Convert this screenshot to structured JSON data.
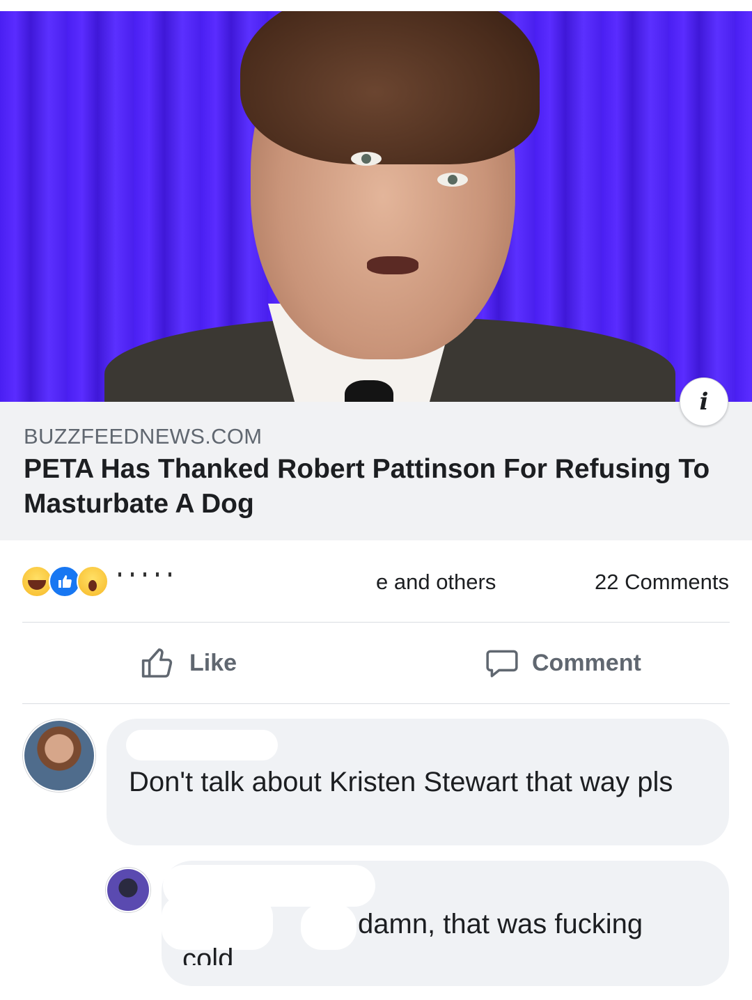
{
  "link_preview": {
    "domain": "BUZZFEEDNEWS.COM",
    "headline": "PETA Has Thanked Robert Pattinson For Refusing To Masturbate A Dog",
    "info_icon": "info-icon"
  },
  "reactions": {
    "icons": [
      "haha-reaction-icon",
      "like-reaction-icon",
      "wow-reaction-icon"
    ],
    "others_text": "e and others",
    "comments_count": "22 Comments"
  },
  "actions": {
    "like_label": "Like",
    "comment_label": "Comment"
  },
  "comments": [
    {
      "text": "Don't talk about Kristen Stewart that way pls"
    },
    {
      "text_visible": "damn, that was fucking",
      "text_cont": "cold"
    }
  ],
  "colors": {
    "like_blue": "#1877f2",
    "caption_bg": "#f1f2f4",
    "bubble_bg": "#f0f2f5",
    "secondary_text": "#606770"
  }
}
